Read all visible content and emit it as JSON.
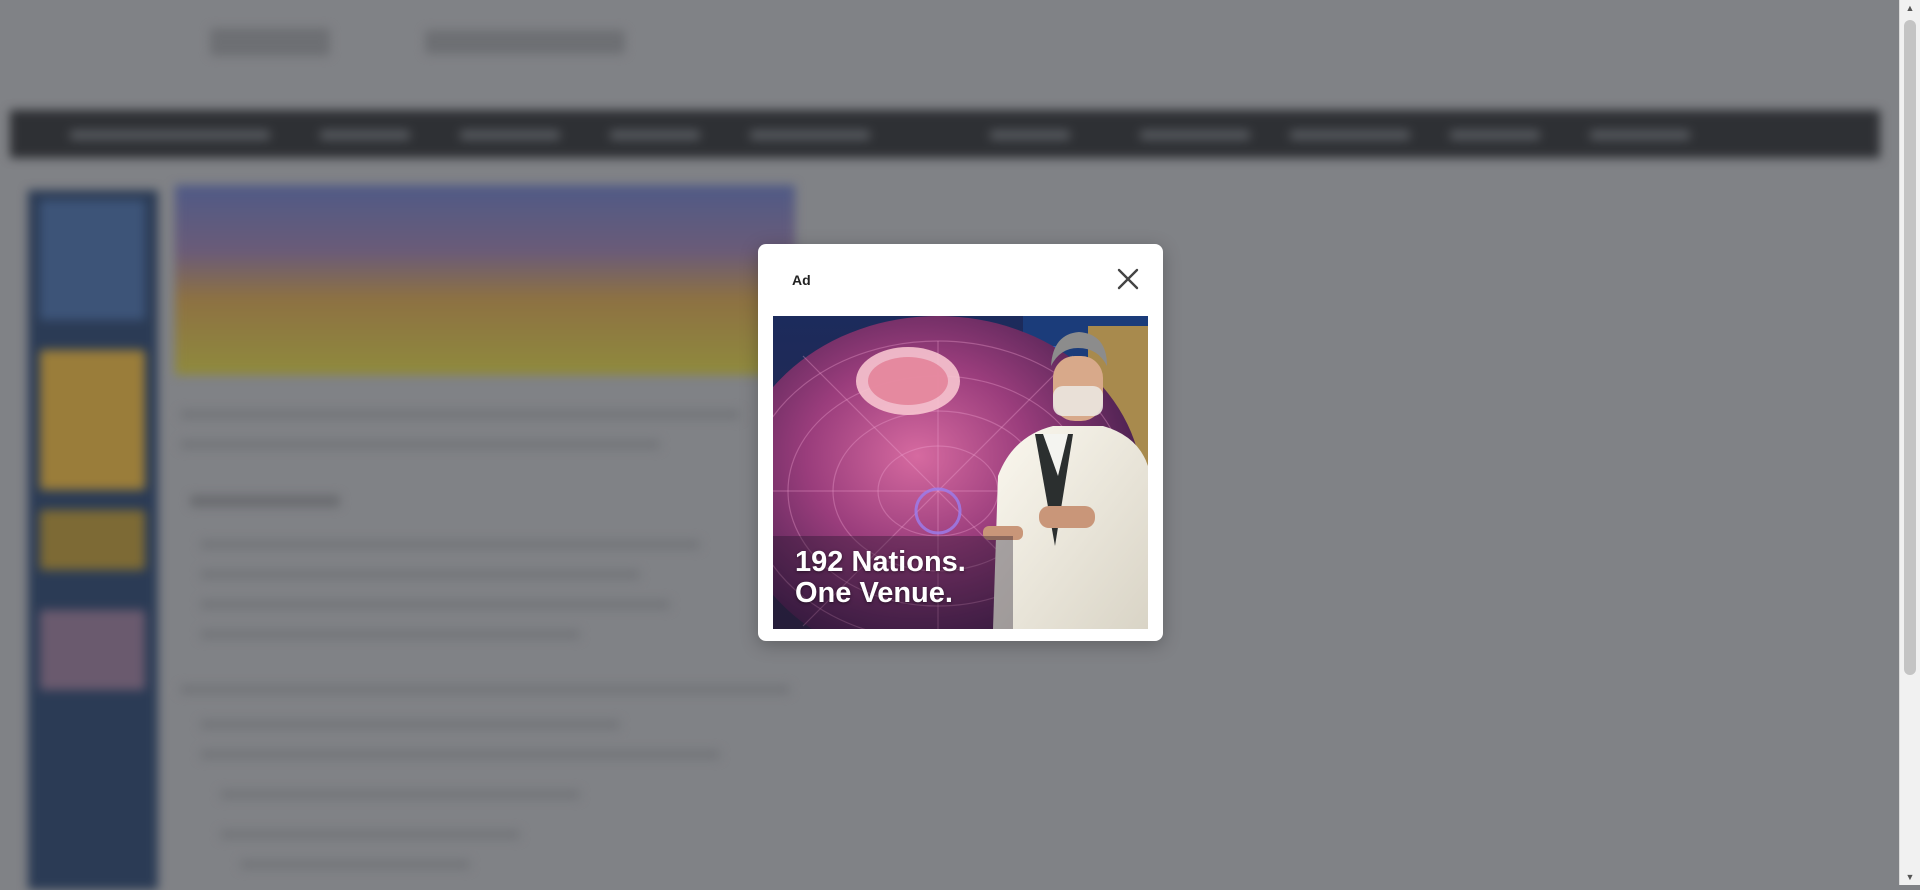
{
  "ad_modal": {
    "label": "Ad",
    "close_icon": "close-icon",
    "headline_line1": "192 Nations.",
    "headline_line2": "One Venue."
  },
  "colors": {
    "overlay": "#808286",
    "modal_bg": "#ffffff",
    "navbar": "#2e3034",
    "sidebar": "#2b3b55"
  }
}
